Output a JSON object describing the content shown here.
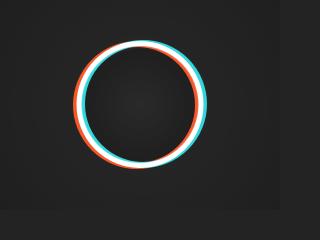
{
  "app": {
    "logo_icon": "glitch-ring-icon",
    "colors": {
      "background": "#232323",
      "ring_main": "#ffffff",
      "ring_left_offset": "#ff5a2a",
      "ring_right_offset": "#31e0e6"
    }
  }
}
